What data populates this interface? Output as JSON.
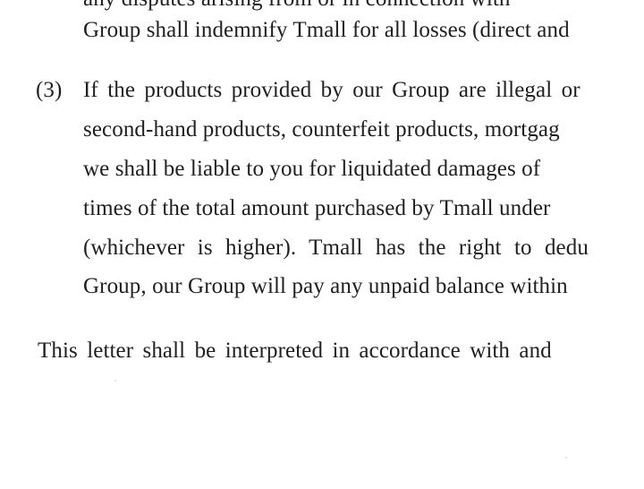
{
  "paragraph_2_tail": {
    "line_partial": "any disputes arising from or in connection with",
    "line_last": "Group shall indemnify Tmall for all losses (direct and"
  },
  "paragraph_3": {
    "number": "(3)",
    "lines": [
      "If the products provided by our Group are illegal or",
      "second-hand products, counterfeit products, mortgag",
      "we shall be liable to you for liquidated damages of",
      "times of the total amount purchased by Tmall under",
      "(whichever is higher). Tmall has the right to dedu",
      "Group, our Group will pay any unpaid balance within"
    ]
  },
  "closing_paragraph": {
    "text": "This letter shall be interpreted in accordance with and"
  }
}
